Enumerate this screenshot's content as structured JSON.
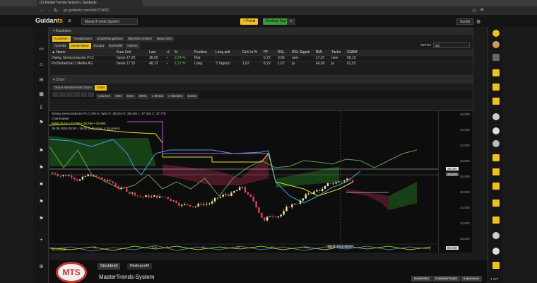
{
  "browser": {
    "tab_title": "(2) MasterTrends-System | Guidants",
    "url": "go.guidants.com/#d/c279652"
  },
  "app": {
    "logo_main": "Guidan",
    "logo_accent": "ts",
    "workspace_select": "MasterTrends-System",
    "btn_add": "+ Portal",
    "btn_green": "Desktop-App",
    "btn_search": "Suche"
  },
  "watchlist": {
    "title": "Kurslisten",
    "tabs": [
      "Kurslisten",
      "Trendphasen",
      "Empfehlungslisten",
      "Watchlist Sortiert",
      "News Jetzt"
    ],
    "subtabs": [
      "Amerika",
      "Deutschland",
      "Europa",
      "Rohstoffe",
      "Indizes"
    ],
    "search_label": "XETRA",
    "search_value": "dia",
    "columns": [
      "Name",
      "Kurs Zeit",
      "Last",
      "+/-",
      "%",
      "Position",
      "Long seit",
      "GuV in %",
      "PF",
      "RSL",
      "RSL-Signal",
      "BMI",
      "Tacho",
      "GSBM"
    ],
    "rows": [
      [
        "Dialog Semiconductor PLC",
        "heute 17:29",
        "38,09",
        "+",
        "2,24 %",
        "Flat",
        "-",
        "-",
        "5,72",
        "0,95",
        "nein",
        "17,37",
        "nein",
        "58,15"
      ],
      [
        "ProSiebenSat.1 Media AG",
        "heute 17:15",
        "48,72",
        "+",
        "1,27 %",
        "Long",
        "3 Tage(n)",
        "1,02",
        "8,22",
        "1,07",
        "ja",
        "40,65",
        "ja",
        "63,53"
      ]
    ]
  },
  "chart_panel": {
    "title": "Chart",
    "tabs": [
      "Depot Mastertrends Depot",
      "Chart"
    ],
    "toolbar": [
      "Volumen",
      "SMA",
      "EMA",
      "WMA",
      "1 Monat",
      "4 Stunden",
      "Extras"
    ],
    "legend_title": "Dialog Semiconductor PLC (ON-X, last)",
    "legend_ohlc": "O: 38,010  H: 38,026  L: 37,325  C: 37,775",
    "legend_indicator": "Chartmaster",
    "legend_values": "RWB 28,52 • 37,725 • 35,668 • 39,890",
    "legend_range": "09.09.2015 08:00 - 19,00 (1 Monate, 4 Stunden)",
    "crosshair_date": "09.11.2015 08:00",
    "price_label_1": "38,080",
    "price_label_2": "36,925",
    "osc_legend": "Stochastik",
    "osc_value": "66,000"
  },
  "chart_data": {
    "type": "line",
    "yticks": [
      "46,000",
      "44,000",
      "42,000",
      "40,000",
      "38,000",
      "36,000",
      "34,000",
      "32,000",
      "30,000"
    ],
    "xticks": [
      "21",
      "Okt",
      "5",
      "12",
      "19",
      "26",
      "Nov"
    ]
  },
  "bottom": {
    "logo": "MTS",
    "tab1": "Steckbrief",
    "tab2": "Risikoprofil",
    "title": "MasterTrends-System",
    "btn1": "Newsletter",
    "btn2": "GuidantsTrader",
    "btn3": "Impressum",
    "count": "1 177"
  },
  "colors": {
    "accent": "#f0c020",
    "green": "#5cc85c",
    "red": "#e04040"
  }
}
